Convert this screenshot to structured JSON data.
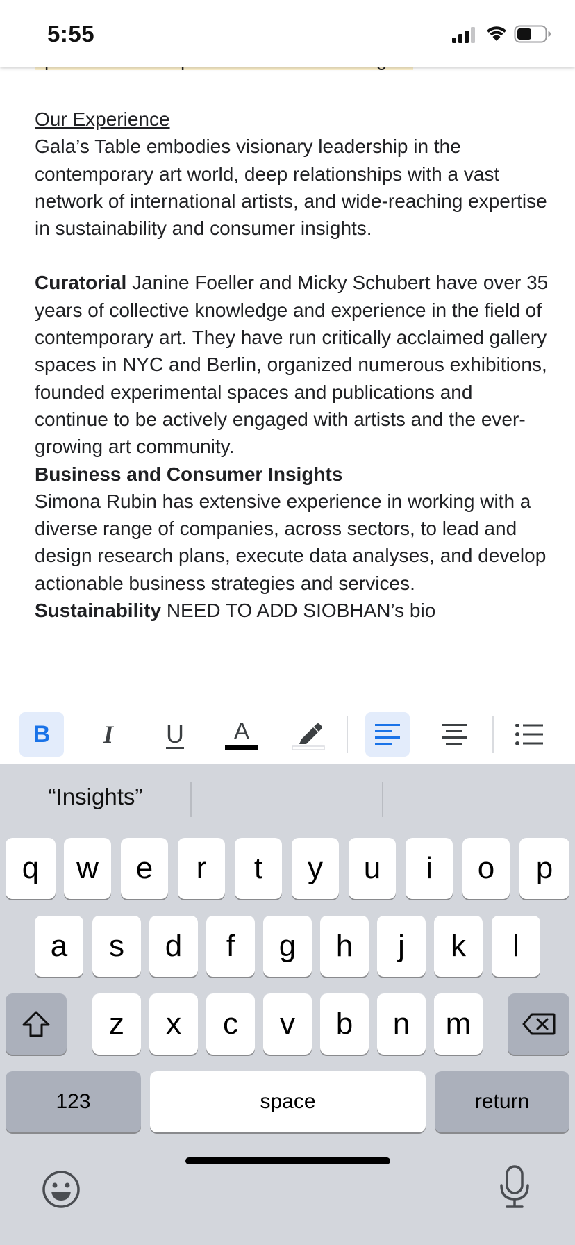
{
  "status": {
    "time": "5:55"
  },
  "document": {
    "cut_line": "specific social impact themes or challenges.",
    "experience_heading": "Our Experience",
    "experience_text": "Gala’s Table embodies visionary leadership in the contemporary art world, deep relationships with a vast network of international artists, and wide-reaching expertise in sustainability and consumer insights.",
    "curatorial_label": "Curatorial",
    "curatorial_text": " Janine Foeller and Micky Schubert have over 35 years of collective knowledge and experience in the field of contemporary art. They have run critically acclaimed gallery spaces in NYC and Berlin, organized numerous exhibitions, founded experimental spaces and publications and continue to be actively engaged with artists and the ever-growing art community.",
    "business_heading": "Business and Consumer Insights",
    "business_text": "Simona Rubin has extensive experience in working with a diverse range of companies, across sectors, to lead and design research plans, execute data analyses, and develop actionable business strategies and services.",
    "sustainability_label": "Sustainability",
    "sustainability_text": " NEED TO ADD SIOBHAN’s bio"
  },
  "toolbar": {
    "bold": "B",
    "italic": "I",
    "underline": "U",
    "text_color": "A",
    "accent_color": "#1a73e8",
    "active_bg": "#e3ecfb"
  },
  "keyboard": {
    "suggestions": [
      "“Insights”",
      "",
      ""
    ],
    "row1": [
      "q",
      "w",
      "e",
      "r",
      "t",
      "y",
      "u",
      "i",
      "o",
      "p"
    ],
    "row2": [
      "a",
      "s",
      "d",
      "f",
      "g",
      "h",
      "j",
      "k",
      "l"
    ],
    "row3": [
      "z",
      "x",
      "c",
      "v",
      "b",
      "n",
      "m"
    ],
    "numbers_label": "123",
    "space_label": "space",
    "return_label": "return"
  }
}
